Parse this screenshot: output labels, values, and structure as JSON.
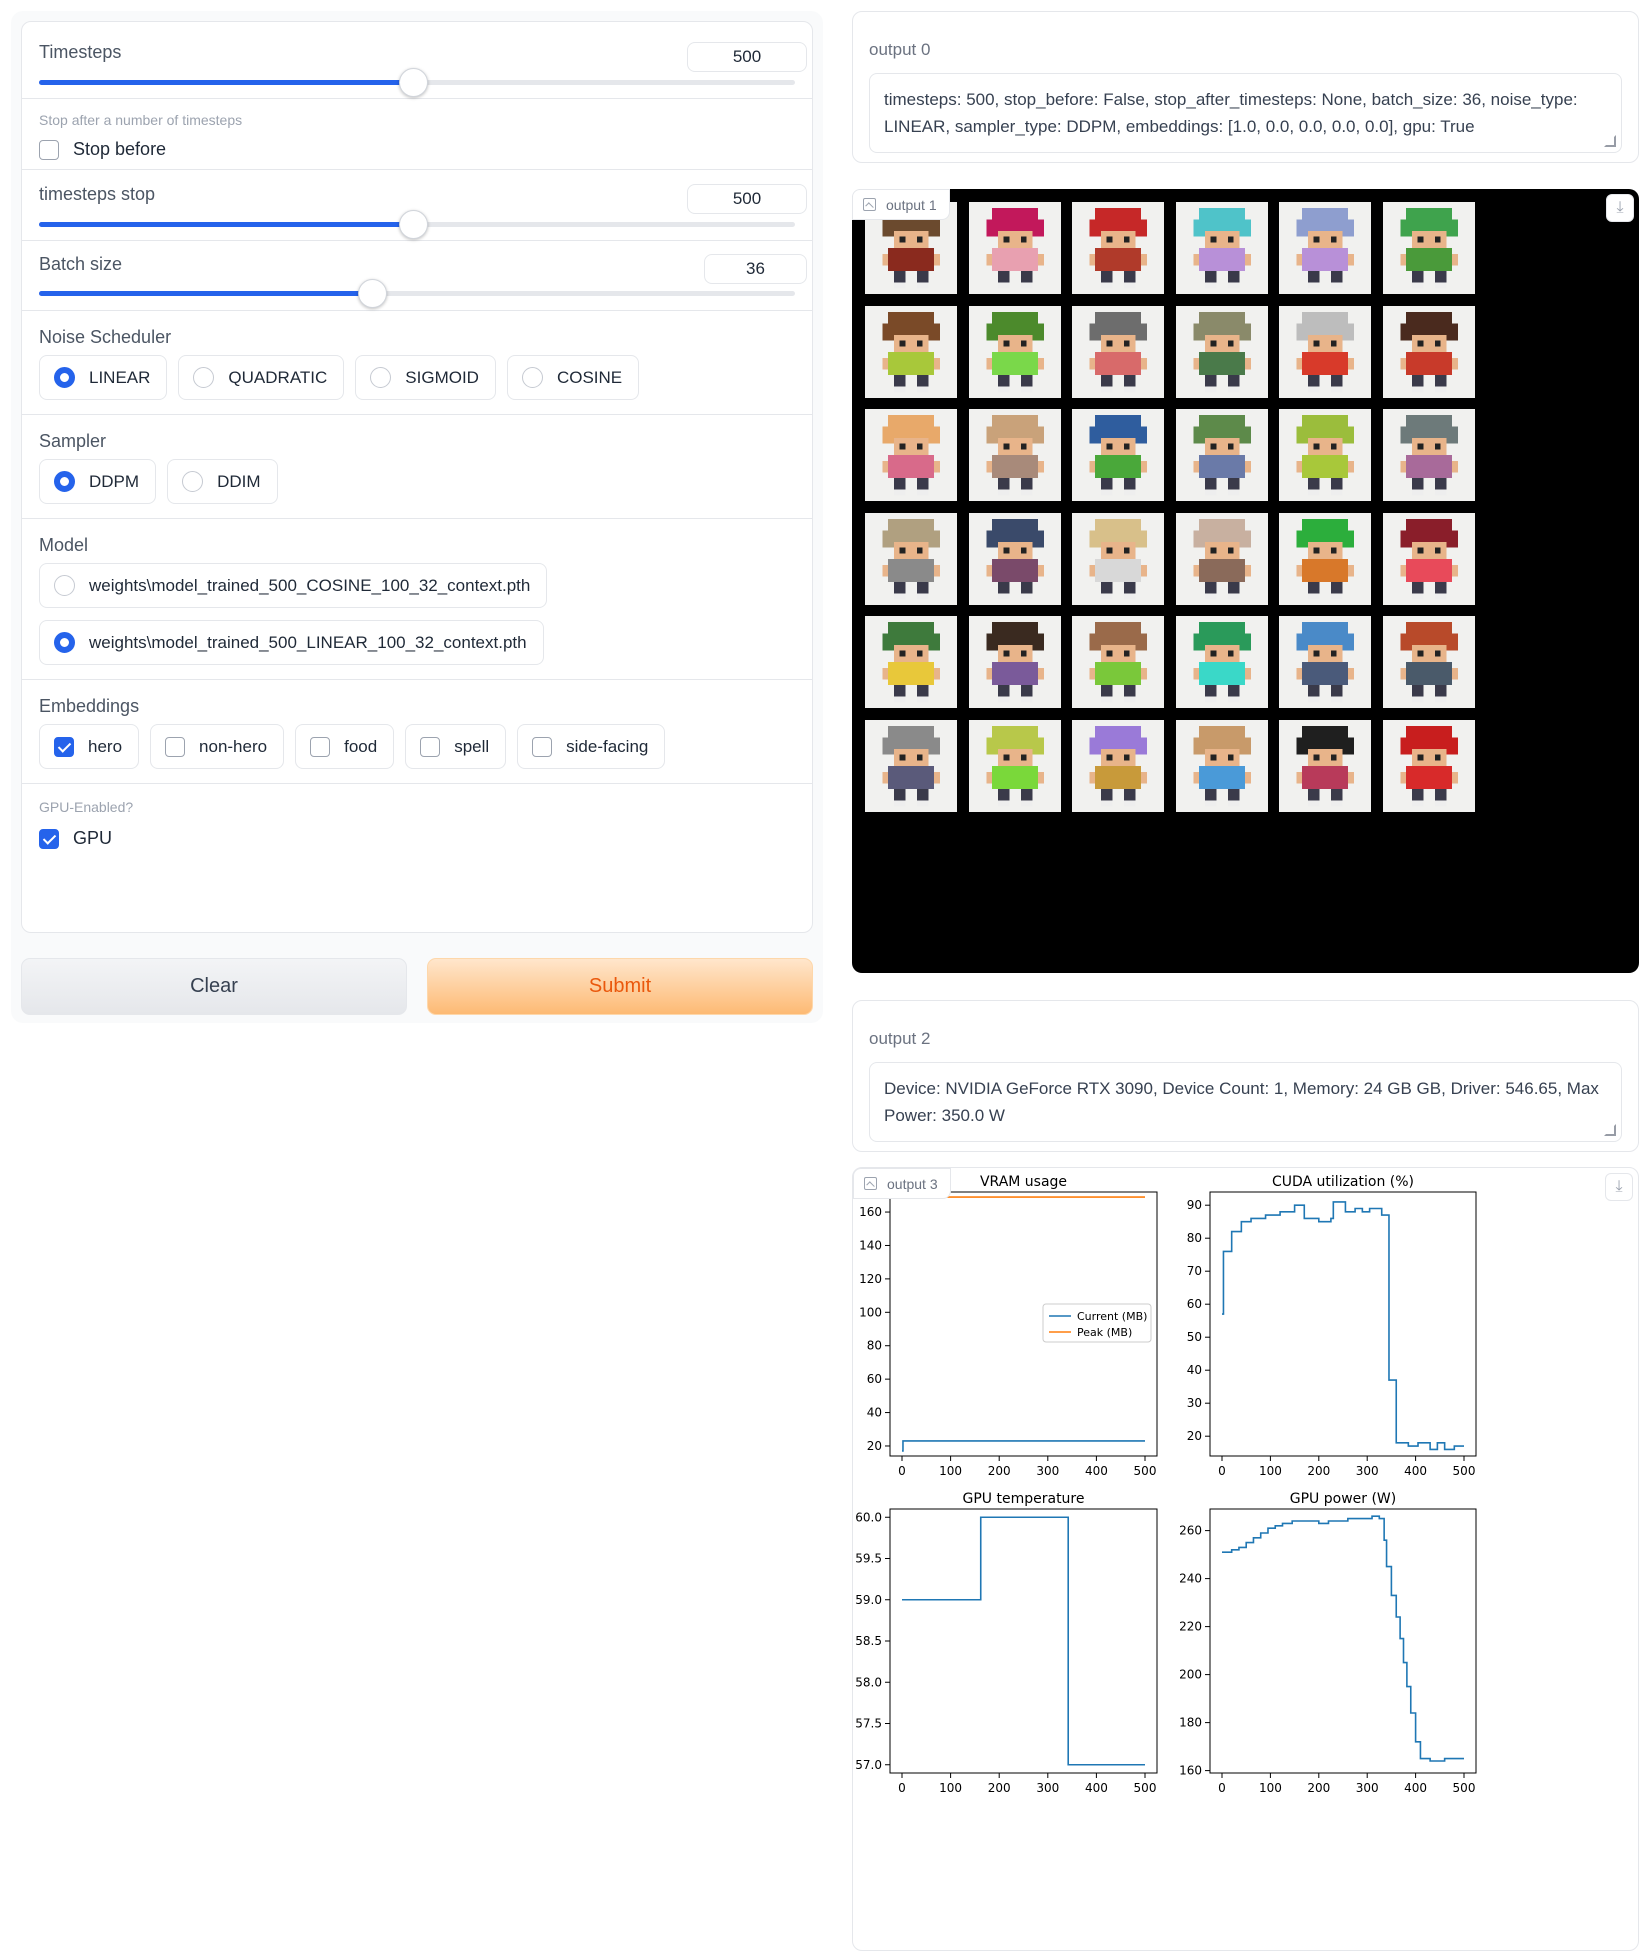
{
  "controls": {
    "timesteps": {
      "label": "Timesteps",
      "value": "500",
      "fraction": 0.495
    },
    "stop_after": {
      "label": "Stop after a number of timesteps",
      "checkbox_label": "Stop before",
      "checked": false
    },
    "timesteps_stop": {
      "label": "timesteps stop",
      "value": "500",
      "fraction": 0.495
    },
    "batch_size": {
      "label": "Batch size",
      "value": "36",
      "fraction": 0.44
    },
    "noise_scheduler": {
      "label": "Noise Scheduler",
      "options": [
        "LINEAR",
        "QUADRATIC",
        "SIGMOID",
        "COSINE"
      ],
      "selected": "LINEAR"
    },
    "sampler": {
      "label": "Sampler",
      "options": [
        "DDPM",
        "DDIM"
      ],
      "selected": "DDPM"
    },
    "model": {
      "label": "Model",
      "options": [
        "weights\\model_trained_500_COSINE_100_32_context.pth",
        "weights\\model_trained_500_LINEAR_100_32_context.pth"
      ],
      "selected": "weights\\model_trained_500_LINEAR_100_32_context.pth"
    },
    "embeddings": {
      "label": "Embeddings",
      "options": [
        {
          "label": "hero",
          "checked": true
        },
        {
          "label": "non-hero",
          "checked": false
        },
        {
          "label": "food",
          "checked": false
        },
        {
          "label": "spell",
          "checked": false
        },
        {
          "label": "side-facing",
          "checked": false
        }
      ]
    },
    "gpu": {
      "label": "GPU-Enabled?",
      "checkbox_label": "GPU",
      "checked": true
    }
  },
  "buttons": {
    "clear": "Clear",
    "submit": "Submit"
  },
  "output0": {
    "label": "output 0",
    "text": "timesteps: 500, stop_before: False, stop_after_timesteps: None, batch_size: 36, noise_type: LINEAR, sampler_type: DDPM, embeddings: [1.0, 0.0, 0.0, 0.0, 0.0], gpu: True"
  },
  "output1": {
    "label": "output 1",
    "icons": {
      "tag": "image-icon",
      "download": "download-icon"
    },
    "sprite_colors": [
      [
        "#6b4a2e",
        "#c2185b",
        "#c62828",
        "#4fc3c9",
        "#8e9ecf",
        "#3fa34d"
      ],
      [
        "#7a4a28",
        "#4c8a2c",
        "#6d6d6d",
        "#8a8a6a",
        "#bdbdbd",
        "#4a2a1e"
      ],
      [
        "#e8a96a",
        "#c9a27a",
        "#2f5d9e",
        "#5d8a4a",
        "#9bbd3c",
        "#6d7a7a"
      ],
      [
        "#b0a080",
        "#3a4a6a",
        "#d8c08a",
        "#c8b0a0",
        "#2cae3c",
        "#8a1e2a"
      ],
      [
        "#3e7a3c",
        "#3a2a20",
        "#9a6a4a",
        "#2a9a5a",
        "#4a8ac8",
        "#b84a2a"
      ],
      [
        "#8a8a8a",
        "#b8c84a",
        "#9a7ad8",
        "#c89a6a",
        "#1f1f1f",
        "#c81e1e"
      ]
    ],
    "body_colors": [
      [
        "#8a2a1e",
        "#e8a0b0",
        "#b03a2a",
        "#b890d8",
        "#b890d8",
        "#4a9a3a"
      ],
      [
        "#a8c83a",
        "#7ad84a",
        "#d86a6a",
        "#4a7a4a",
        "#d83a2a",
        "#c83a2a"
      ],
      [
        "#d86a8a",
        "#a88a7a",
        "#4aa83a",
        "#6a7aa8",
        "#a8c83a",
        "#a86a9a"
      ],
      [
        "#8a8a8a",
        "#7a4a6a",
        "#d8d8d8",
        "#8a6a5a",
        "#d8782a",
        "#e84a5a"
      ],
      [
        "#e8c83a",
        "#7a5a9a",
        "#7ac83a",
        "#3ad8c8",
        "#4a5a7a",
        "#4a5a6a"
      ],
      [
        "#5a5a7a",
        "#7ad83a",
        "#c89a3a",
        "#4a9ad8",
        "#b83a5a",
        "#d82a2a"
      ]
    ]
  },
  "output2": {
    "label": "output 2",
    "text": "Device: NVIDIA GeForce RTX 3090, Device Count: 1, Memory: 24 GB GB, Driver: 546.65, Max Power: 350.0 W"
  },
  "output3": {
    "label": "output 3",
    "icons": {
      "tag": "image-icon",
      "download": "download-icon"
    }
  },
  "chart_data": [
    {
      "type": "line",
      "title": "VRAM usage",
      "xlim": [
        0,
        500
      ],
      "ylim": [
        14,
        172
      ],
      "xticks": [
        0,
        100,
        200,
        300,
        400,
        500
      ],
      "yticks": [
        20,
        40,
        60,
        80,
        100,
        120,
        140,
        160
      ],
      "ytick_labels": [
        "20",
        "40",
        "60",
        "80",
        "100",
        "120",
        "140",
        "160"
      ],
      "legend": "center-right",
      "series": [
        {
          "name": "Current (MB)",
          "color": "#1f77b4",
          "step": true,
          "points": [
            [
              0,
              17
            ],
            [
              2,
              23
            ],
            [
              500,
              23
            ]
          ]
        },
        {
          "name": "Peak (MB)",
          "color": "#ff7f0e",
          "step": true,
          "points": [
            [
              0,
              169
            ],
            [
              500,
              169
            ]
          ]
        }
      ]
    },
    {
      "type": "line",
      "title": "CUDA utilization (%)",
      "xlim": [
        0,
        500
      ],
      "ylim": [
        14,
        94
      ],
      "xticks": [
        0,
        100,
        200,
        300,
        400,
        500
      ],
      "yticks": [
        20,
        30,
        40,
        50,
        60,
        70,
        80,
        90
      ],
      "ytick_labels": [
        "20",
        "30",
        "40",
        "50",
        "60",
        "70",
        "80",
        "90"
      ],
      "series": [
        {
          "name": "",
          "color": "#1f77b4",
          "step": true,
          "points": [
            [
              0,
              57
            ],
            [
              3,
              76
            ],
            [
              20,
              82
            ],
            [
              40,
              85
            ],
            [
              60,
              86
            ],
            [
              90,
              87
            ],
            [
              120,
              88
            ],
            [
              150,
              90
            ],
            [
              170,
              86
            ],
            [
              200,
              85
            ],
            [
              225,
              86
            ],
            [
              230,
              91
            ],
            [
              255,
              88
            ],
            [
              275,
              89
            ],
            [
              290,
              88
            ],
            [
              305,
              89
            ],
            [
              330,
              87
            ],
            [
              345,
              37
            ],
            [
              360,
              18
            ],
            [
              385,
              17
            ],
            [
              405,
              18
            ],
            [
              430,
              16
            ],
            [
              445,
              18
            ],
            [
              460,
              16
            ],
            [
              480,
              17
            ],
            [
              500,
              17
            ]
          ]
        }
      ]
    },
    {
      "type": "line",
      "title": "GPU temperature",
      "xlim": [
        0,
        500
      ],
      "ylim": [
        56.9,
        60.1
      ],
      "xticks": [
        0,
        100,
        200,
        300,
        400,
        500
      ],
      "yticks": [
        57.0,
        57.5,
        58.0,
        58.5,
        59.0,
        59.5,
        60.0
      ],
      "ytick_labels": [
        "57.0",
        "57.5",
        "58.0",
        "58.5",
        "59.0",
        "59.5",
        "60.0"
      ],
      "series": [
        {
          "name": "",
          "color": "#1f77b4",
          "step": true,
          "points": [
            [
              0,
              59.0
            ],
            [
              162,
              60.0
            ],
            [
              342,
              57.0
            ],
            [
              500,
              57.0
            ]
          ]
        }
      ]
    },
    {
      "type": "line",
      "title": "GPU power (W)",
      "xlim": [
        0,
        500
      ],
      "ylim": [
        159,
        269
      ],
      "xticks": [
        0,
        100,
        200,
        300,
        400,
        500
      ],
      "yticks": [
        160,
        180,
        200,
        220,
        240,
        260
      ],
      "ytick_labels": [
        "160",
        "180",
        "200",
        "220",
        "240",
        "260"
      ],
      "series": [
        {
          "name": "",
          "color": "#1f77b4",
          "step": true,
          "points": [
            [
              0,
              251
            ],
            [
              20,
              252
            ],
            [
              35,
              253
            ],
            [
              50,
              255
            ],
            [
              65,
              257
            ],
            [
              80,
              259
            ],
            [
              95,
              261
            ],
            [
              110,
              262
            ],
            [
              125,
              263
            ],
            [
              145,
              264
            ],
            [
              200,
              263
            ],
            [
              220,
              264
            ],
            [
              260,
              265
            ],
            [
              300,
              265
            ],
            [
              310,
              266
            ],
            [
              325,
              265
            ],
            [
              335,
              256
            ],
            [
              340,
              245
            ],
            [
              350,
              233
            ],
            [
              360,
              224
            ],
            [
              368,
              215
            ],
            [
              375,
              205
            ],
            [
              382,
              195
            ],
            [
              390,
              184
            ],
            [
              400,
              172
            ],
            [
              410,
              165
            ],
            [
              430,
              164
            ],
            [
              460,
              165
            ],
            [
              500,
              165
            ]
          ]
        }
      ]
    }
  ]
}
